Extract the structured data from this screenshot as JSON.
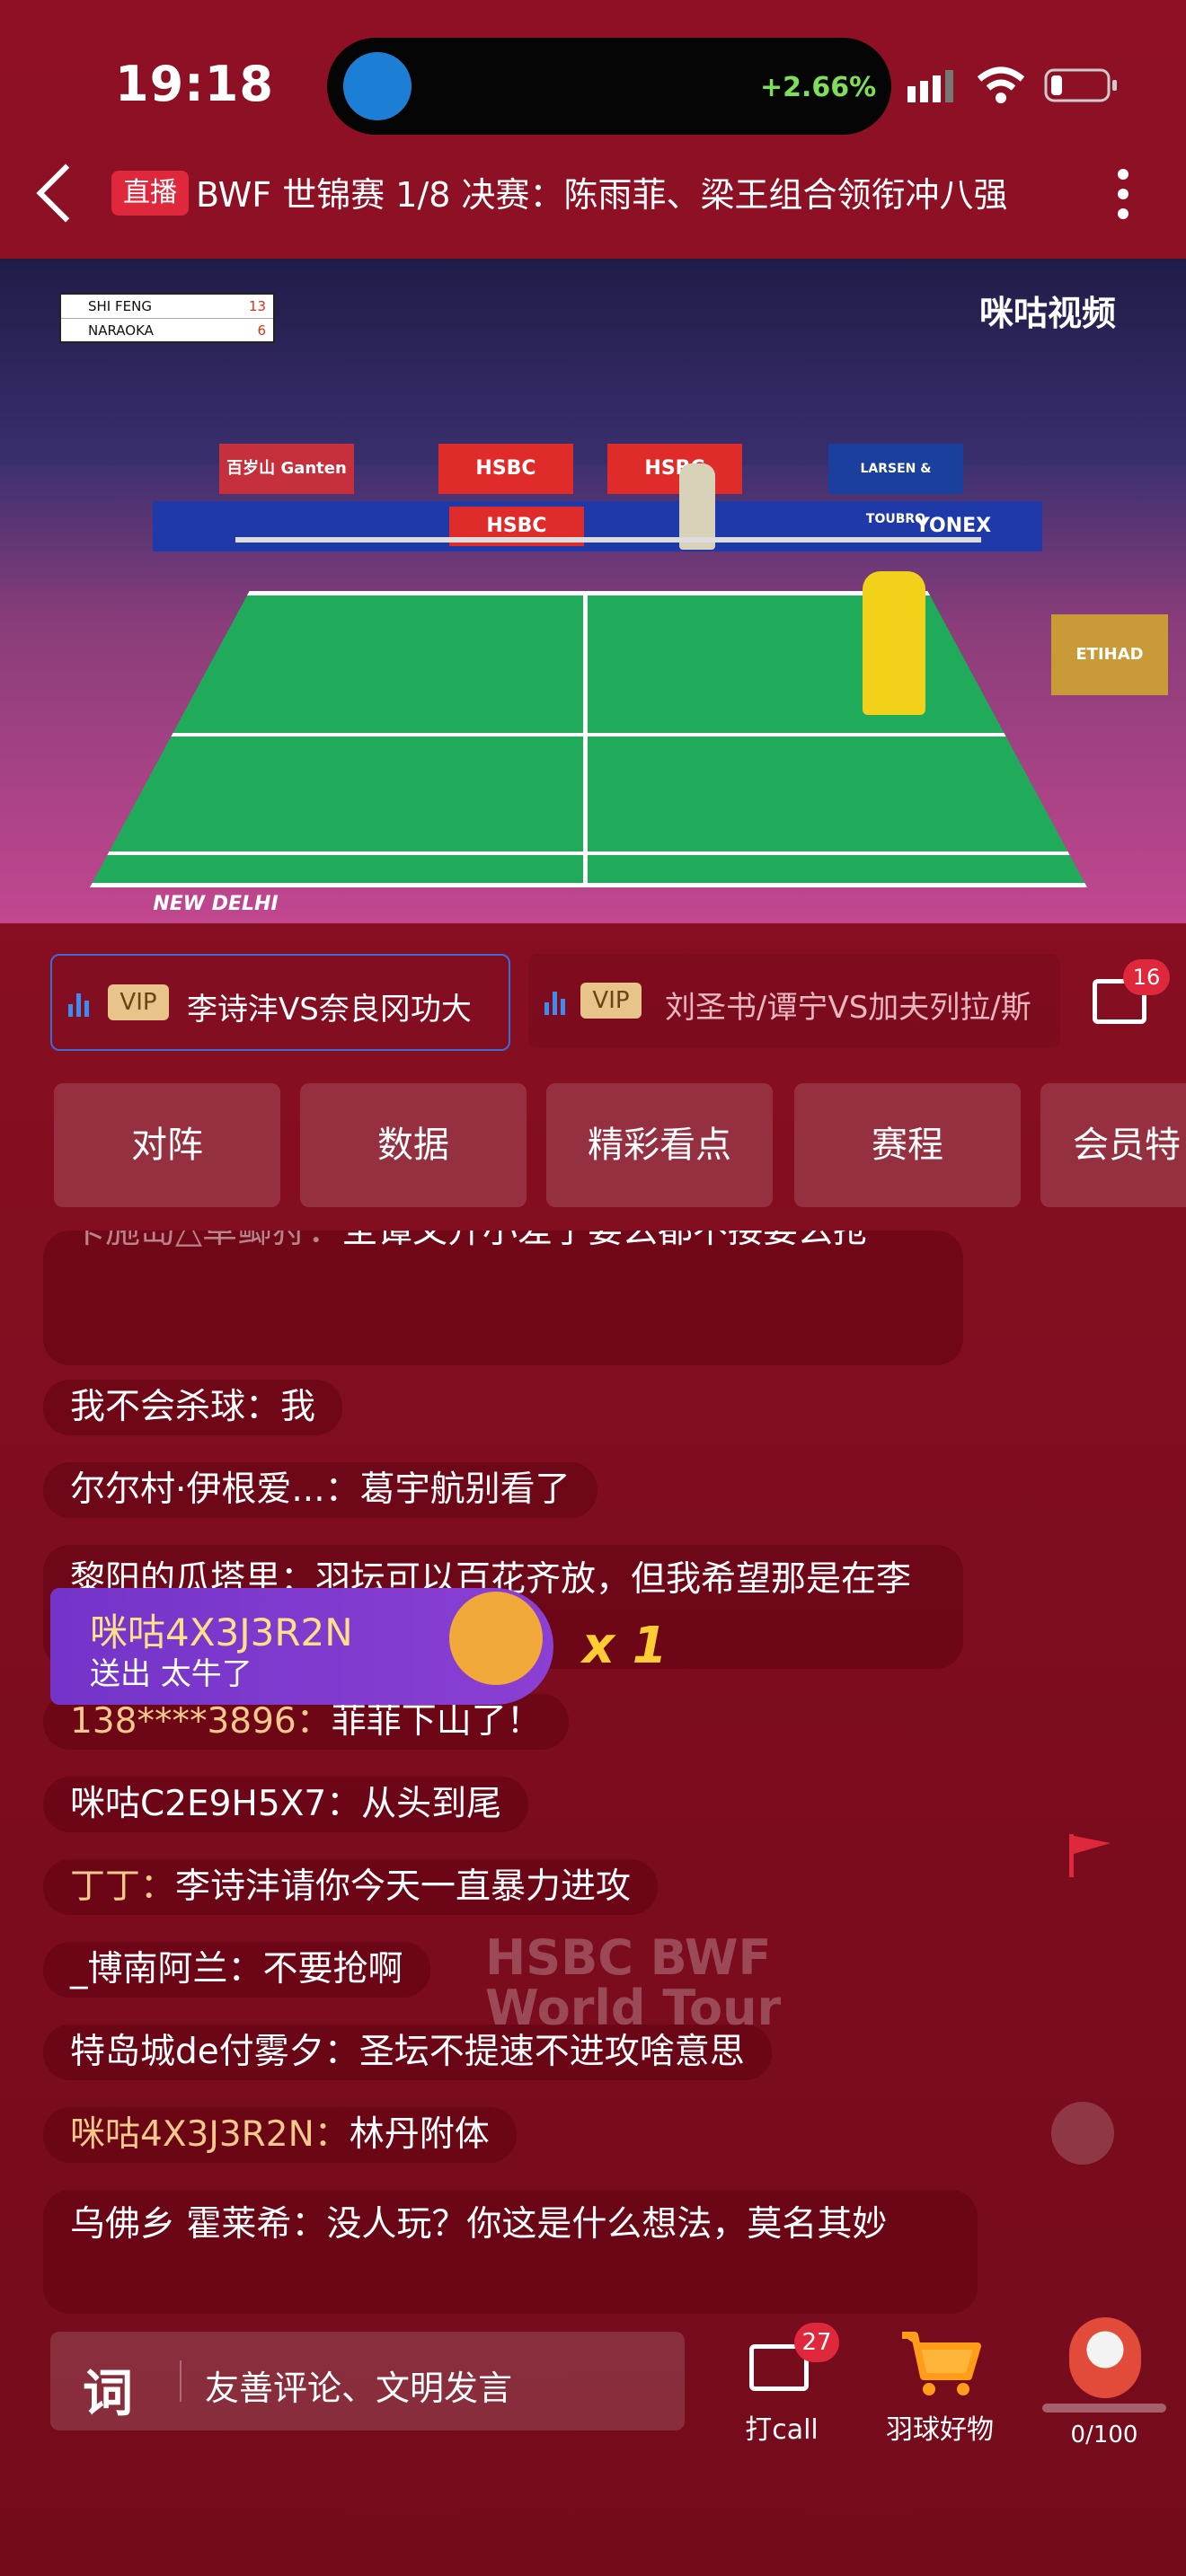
{
  "status_bar": {
    "time": "19:18",
    "percent": "+2.66%"
  },
  "header": {
    "live_badge": "直播",
    "title": "BWF 世锦赛 1/8 决赛：陈雨菲、梁王组合领衔冲八强"
  },
  "video": {
    "scoreboard": [
      {
        "name": "SHI FENG",
        "score": "13"
      },
      {
        "name": "NARAOKA",
        "score": "6"
      }
    ],
    "logo": "咪咕视频",
    "ads": [
      "HSBC",
      "HSBC",
      "HSBC",
      "YONEX",
      "ETIHAD",
      "LARSEN & TOUBRO",
      "百岁山 Ganten",
      "NEW DELHI"
    ]
  },
  "match_tabs": [
    {
      "vip": "VIP",
      "label": "李诗沣VS奈良冈功大"
    },
    {
      "vip": "VIP",
      "label": "刘圣书/谭宁VS加夫列拉/斯"
    }
  ],
  "replay_badge": "16",
  "action_tabs": [
    "对阵",
    "数据",
    "精彩看点",
    "赛程",
    "会员特"
  ],
  "chat": [
    {
      "user": "卡施岛△草鲫狩：",
      "text": "圣谭又开小差了要么都不接要么抢",
      "gold": false
    },
    {
      "user": "我不会杀球：",
      "text": "我",
      "gold": false
    },
    {
      "user": "尔尔村·伊根爱...：",
      "text": "葛宇航别看了",
      "gold": false
    },
    {
      "user": "黎阳的瓜塔里：",
      "text": "羽坛可以百花齐放，但我希望那是在李诗沣独秀之后",
      "gold": false
    },
    {
      "user": "138****3896：",
      "text": "菲菲下山了！",
      "gold": true
    },
    {
      "user": "咪咕C2E9H5X7：",
      "text": "从头到尾",
      "gold": false
    },
    {
      "user": "丁丁：",
      "text": "李诗沣请你今天一直暴力进攻",
      "gold": true
    },
    {
      "user": "_博南阿兰：",
      "text": "不要抢啊",
      "gold": false
    },
    {
      "user": "特岛城de付雾夕：",
      "text": "圣坛不提速不进攻啥意思",
      "gold": false
    },
    {
      "user": "咪咕4X3J3R2N：",
      "text": "林丹附体",
      "gold": true
    },
    {
      "user": "乌佛乡 霍莱希：",
      "text": "没人玩？你这是什么想法，莫名其妙",
      "gold": false
    }
  ],
  "gift": {
    "user": "咪咕4X3J3R2N",
    "action": "送出 太牛了",
    "count": "x 1"
  },
  "watermark": [
    "HSBC BWF",
    "World Tour"
  ],
  "bottom": {
    "input_icon": "词",
    "placeholder": "友善评论、文明发言",
    "call_label": "打call",
    "call_badge": "27",
    "shop_label": "羽球好物",
    "progress": "0/100"
  }
}
